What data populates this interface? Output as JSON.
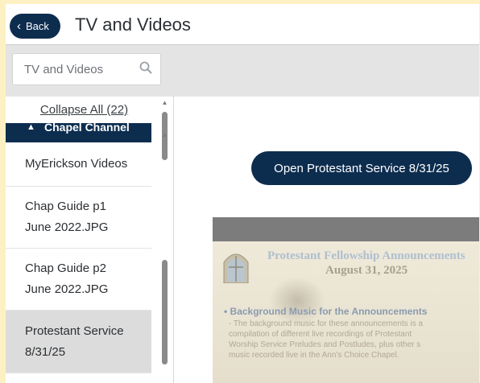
{
  "header": {
    "back_label": "Back",
    "title": "TV and Videos"
  },
  "search": {
    "placeholder": "TV and Videos"
  },
  "sidebar": {
    "collapse_label": "Collapse All (22)",
    "section_label": "Chapel Channel",
    "items": [
      {
        "label": "MyErickson Videos"
      },
      {
        "label_line1": "Chap Guide p1",
        "label_line2": "June 2022.JPG"
      },
      {
        "label_line1": "Chap Guide p2",
        "label_line2": "June 2022.JPG"
      },
      {
        "label_line1": "Protestant Service",
        "label_line2": "8/31/25",
        "active": true
      }
    ]
  },
  "main": {
    "open_button_label": "Open Protestant Service 8/31/25",
    "preview": {
      "title": "Protestant Fellowship Announcements",
      "date": "August 31, 2025",
      "subheading": "• Background Music for the Announcements",
      "lines": [
        "- The background music for these announcements is a",
        "compilation of different live recordings of Protestant",
        "Worship Service Preludes and Postludes, plus other s",
        "music recorded live in the Ann's Choice Chapel."
      ]
    }
  },
  "colors": {
    "accent": "#0d2d4f",
    "page_background": "#fdf1c3",
    "active_item": "#dcdcdc"
  }
}
